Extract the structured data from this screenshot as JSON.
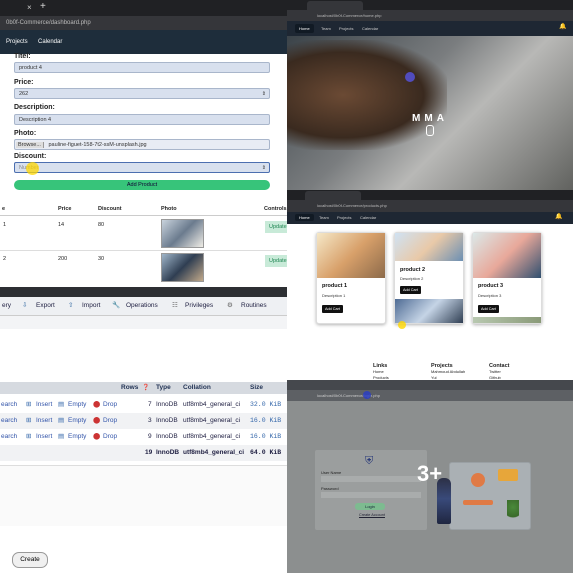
{
  "left": {
    "url": "0b0f-Commerce/dashboard.php",
    "nav": [
      "Projects",
      "Calendar"
    ],
    "form": {
      "titel_label": "Titel:",
      "titel_value": "product 4",
      "price_label": "Price:",
      "price_value": "262",
      "description_label": "Description:",
      "description_value": "Description 4",
      "photo_label": "Photo:",
      "browse": "Browse...",
      "filename": "pauline-figuet-158-7t2-ssM-unsplash.jpg",
      "discount_label": "Discount:",
      "discount_placeholder": "Number",
      "add_button": "Add Product"
    },
    "table": {
      "headers": [
        "e",
        "Price",
        "Discount",
        "Photo",
        "Controls"
      ],
      "rows": [
        {
          "id": "1",
          "price": "14",
          "discount": "80",
          "control": "Update"
        },
        {
          "id": "2",
          "price": "200",
          "discount": "30",
          "control": "Update"
        }
      ]
    },
    "pma_tabs": [
      "ery",
      "Export",
      "Import",
      "Operations",
      "Privileges",
      "Routines"
    ],
    "pma_headers": [
      "Rows",
      "Type",
      "Collation",
      "Size"
    ],
    "pma_rows": [
      {
        "a": "earch",
        "b": "Insert",
        "c": "Empty",
        "d": "Drop",
        "rows": "7",
        "type": "InnoDB",
        "coll": "utf8mb4_general_ci",
        "size": "32.0 KiB"
      },
      {
        "a": "earch",
        "b": "Insert",
        "c": "Empty",
        "d": "Drop",
        "rows": "3",
        "type": "InnoDB",
        "coll": "utf8mb4_general_ci",
        "size": "16.0 KiB"
      },
      {
        "a": "earch",
        "b": "Insert",
        "c": "Empty",
        "d": "Drop",
        "rows": "9",
        "type": "InnoDB",
        "coll": "utf8mb4_general_ci",
        "size": "16.0 KiB"
      }
    ],
    "pma_total": {
      "rows": "19",
      "type": "InnoDB",
      "coll": "utf8mb4_general_ci",
      "size": "64.0 KiB"
    },
    "create": "Create"
  },
  "tr": {
    "url": "localhost/0b0f-Commerce/home.php",
    "nav": [
      "Home",
      "Team",
      "Projects",
      "Calendar"
    ],
    "hero": "MMA"
  },
  "mr": {
    "url": "localhost/0b0f-Commerce/products.php",
    "nav": [
      "Home",
      "Team",
      "Projects",
      "Calendar"
    ],
    "products": [
      {
        "title": "product 1",
        "desc": "Description 1",
        "btn": "Add Cart"
      },
      {
        "title": "product 2",
        "desc": "Description 2",
        "btn": "Add Cart"
      },
      {
        "title": "product 3",
        "desc": "Description 3",
        "btn": "Add Cart"
      }
    ],
    "footer": {
      "links_title": "Links",
      "links": [
        "Home",
        "Products"
      ],
      "projects_title": "Projects",
      "projects": [
        "Mahmoud Abdullah",
        "Yui"
      ],
      "contact_title": "Contact",
      "contact": [
        "Twitter",
        "Github"
      ]
    }
  },
  "br": {
    "url": "localhost/0b0f-Commerce/login.php",
    "username": "User Name",
    "password": "Password",
    "login": "Login",
    "create_account": "Create Account",
    "badge": "3+"
  }
}
